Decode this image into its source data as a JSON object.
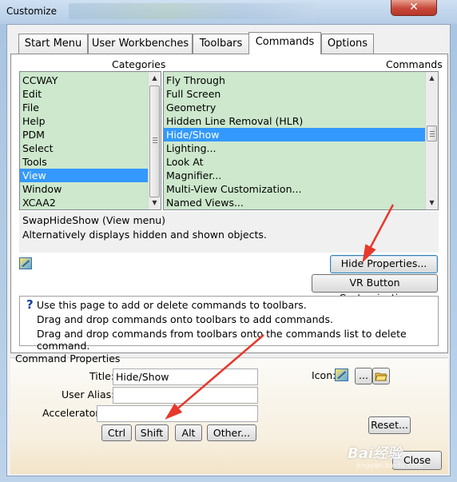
{
  "window": {
    "title": "Customize",
    "close_glyph": "✕"
  },
  "tabs": [
    {
      "label": "Start Menu"
    },
    {
      "label": "User Workbenches"
    },
    {
      "label": "Toolbars"
    },
    {
      "label": "Commands",
      "active": true
    },
    {
      "label": "Options"
    }
  ],
  "categories": {
    "header": "Categories",
    "items": [
      "CCWAY",
      "Edit",
      "File",
      "Help",
      "PDM",
      "Select",
      "Tools",
      "View",
      "Window",
      "XCAA2"
    ],
    "selected": "View"
  },
  "commands": {
    "header": "Commands",
    "items": [
      "Fly Through",
      "Full Screen",
      "Geometry",
      "Hidden Line Removal (HLR)",
      "Hide/Show",
      "Lighting...",
      "Look At",
      "Magnifier...",
      "Multi-View Customization...",
      "Named Views..."
    ],
    "selected": "Hide/Show"
  },
  "description": {
    "line1": "SwapHideShow (View menu)",
    "line2": "Alternatively displays hidden and shown objects."
  },
  "buttons": {
    "hide_properties": "Hide Properties...",
    "vr_customization": "VR Button Customization",
    "reset": "Reset...",
    "close": "Close",
    "ctrl": "Ctrl",
    "shift": "Shift",
    "alt": "Alt",
    "other": "Other...",
    "browse": "..."
  },
  "help": {
    "icon": "?",
    "line1": "Use this page to add or delete commands to toolbars.",
    "line2": "Drag and drop commands onto toolbars to add commands.",
    "line3": "Drag and drop commands from toolbars onto the commands list to delete command."
  },
  "command_properties": {
    "group_label": "Command Properties",
    "title_label": "Title:",
    "title_value": "Hide/Show",
    "alias_label": "User Alias:",
    "alias_value": "",
    "accelerator_label": "Accelerator:",
    "accelerator_value": "",
    "icon_label": "Icon:"
  },
  "watermark": {
    "text": "Bai经验",
    "sub": "jingyan.baidu.com"
  },
  "colors": {
    "list_bg": "#cde8cd",
    "selection": "#3399ff",
    "annotation_arrow": "#e8372c"
  }
}
